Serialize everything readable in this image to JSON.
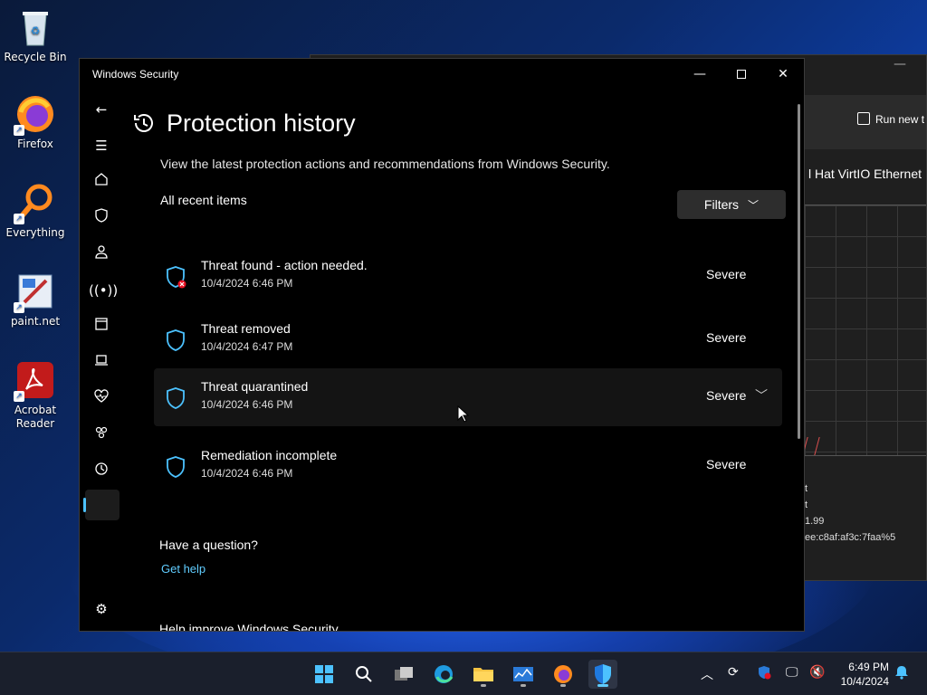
{
  "desktop": {
    "icons": [
      {
        "label": "Recycle Bin"
      },
      {
        "label": "Firefox"
      },
      {
        "label": "Everything"
      },
      {
        "label": "paint.net"
      },
      {
        "label": "Acrobat Reader"
      }
    ]
  },
  "background_window": {
    "run_new_task": "Run new t",
    "adapter_name": "l Hat VirtIO Ethernet",
    "net_lines": [
      "t",
      "t",
      "1.99",
      "ee:c8af:af3c:7faa%5"
    ]
  },
  "window": {
    "title": "Windows Security",
    "controls": {
      "minimize": "—",
      "maximize": "",
      "close": "✕"
    }
  },
  "page": {
    "title": "Protection history",
    "subtitle": "View the latest protection actions and recommendations from Windows Security.",
    "section_label": "All recent items",
    "filters_label": "Filters"
  },
  "items": [
    {
      "title": "Threat found - action needed.",
      "date": "10/4/2024 6:46 PM",
      "severity": "Severe",
      "alert": true
    },
    {
      "title": "Threat removed",
      "date": "10/4/2024 6:47 PM",
      "severity": "Severe",
      "alert": false
    },
    {
      "title": "Threat quarantined",
      "date": "10/4/2024 6:46 PM",
      "severity": "Severe",
      "alert": false
    },
    {
      "title": "Remediation incomplete",
      "date": "10/4/2024 6:46 PM",
      "severity": "Severe",
      "alert": false
    }
  ],
  "help": {
    "question": "Have a question?",
    "link": "Get help",
    "improve": "Help improve Windows Security"
  },
  "taskbar": {
    "clock_time": "6:49 PM",
    "clock_date": "10/4/2024"
  },
  "colors": {
    "accent": "#60cdff",
    "shield": "#4cc2ff",
    "alert": "#e81123"
  }
}
